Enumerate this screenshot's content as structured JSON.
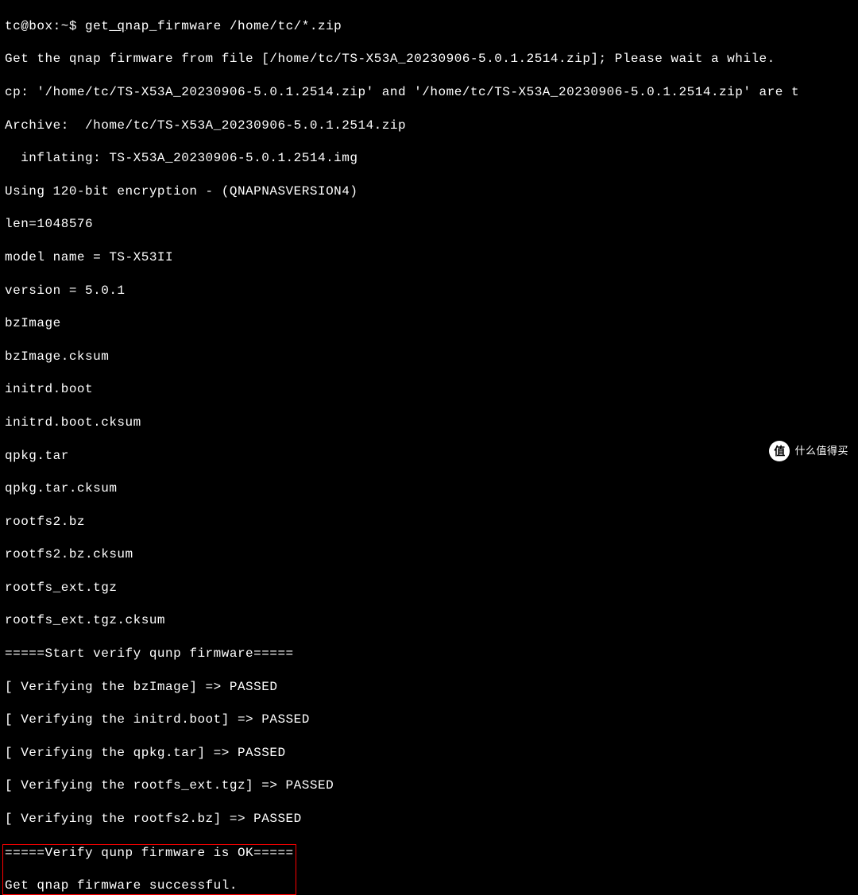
{
  "terminal": {
    "prompt": "tc@box:~$ ",
    "command_prefix": "get",
    "command_underlined": "_q",
    "command_suffix": "nap_firmware /home/tc/*.zip",
    "lines": [
      "Get the qnap firmware from file [/home/tc/TS-X53A_20230906-5.0.1.2514.zip]; Please wait a while.",
      "cp: '/home/tc/TS-X53A_20230906-5.0.1.2514.zip' and '/home/tc/TS-X53A_20230906-5.0.1.2514.zip' are t",
      "Archive:  /home/tc/TS-X53A_20230906-5.0.1.2514.zip",
      "  inflating: TS-X53A_20230906-5.0.1.2514.img",
      "Using 120-bit encryption - (QNAPNASVERSION4)",
      "len=1048576",
      "model name = TS-X53II",
      "version = 5.0.1",
      "bzImage",
      "bzImage.cksum",
      "initrd.boot",
      "initrd.boot.cksum",
      "qpkg.tar",
      "qpkg.tar.cksum",
      "rootfs2.bz",
      "rootfs2.bz.cksum",
      "rootfs_ext.tgz",
      "rootfs_ext.tgz.cksum",
      "=====Start verify qunp firmware=====",
      "[ Verifying the bzImage] => PASSED",
      "[ Verifying the initrd.boot] => PASSED",
      "[ Verifying the qpkg.tar] => PASSED",
      "[ Verifying the rootfs_ext.tgz] => PASSED",
      "[ Verifying the rootfs2.bz] => PASSED"
    ],
    "highlighted": [
      "=====Verify qunp firmware is OK=====",
      "Get qnap firmware successful."
    ]
  },
  "watermark": {
    "icon": "值",
    "text": "什么值得买"
  }
}
